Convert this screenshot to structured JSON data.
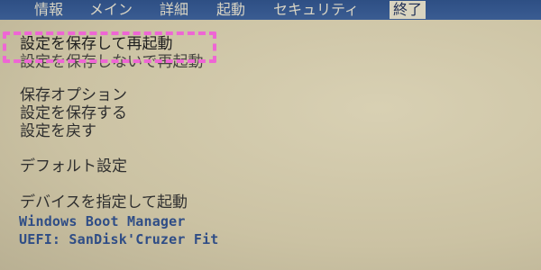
{
  "tabs": [
    {
      "label": "情報"
    },
    {
      "label": "メイン"
    },
    {
      "label": "詳細"
    },
    {
      "label": "起動"
    },
    {
      "label": "セキュリティ"
    },
    {
      "label": "終了",
      "active": true
    }
  ],
  "exit_menu": {
    "save_and_restart": "設定を保存して再起動",
    "discard_and_restart": "設定を保存しないで再起動",
    "save_options_header": "保存オプション",
    "save_settings": "設定を保存する",
    "restore_settings": "設定を戻す",
    "default_settings": "デフォルト設定",
    "boot_override_header": "デバイスを指定して起動",
    "boot_devices": [
      "Windows Boot Manager",
      "UEFI: SanDisk'Cruzer Fit"
    ]
  },
  "colors": {
    "tabbar": "#2e4f84",
    "highlight": "#ee66d4",
    "boot_device_text": "#2f4d86"
  }
}
